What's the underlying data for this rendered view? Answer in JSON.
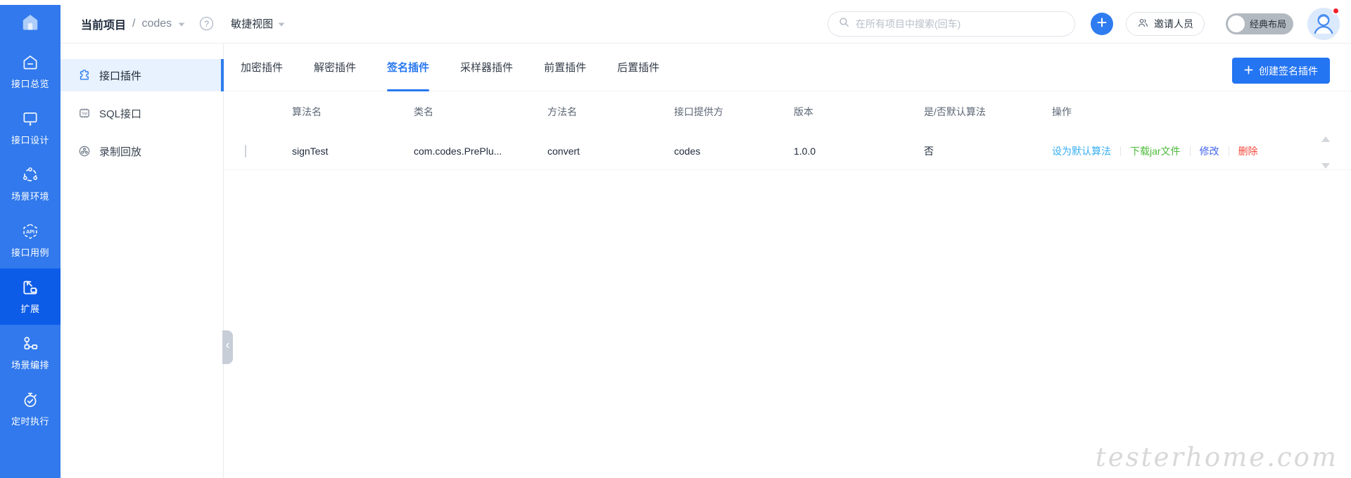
{
  "header": {
    "breadcrumb": {
      "label": "当前项目",
      "separator": "/",
      "project": "codes"
    },
    "view_switcher": "敏捷视图",
    "help": "?",
    "search": {
      "placeholder": "在所有项目中搜索(回车)"
    },
    "invite_button": "邀请人员",
    "layout_toggle": "经典布局"
  },
  "sidebar": {
    "items": [
      {
        "label": "接口总览",
        "icon": "api-overview-icon",
        "active": false
      },
      {
        "label": "接口设计",
        "icon": "api-design-icon",
        "active": false
      },
      {
        "label": "场景环境",
        "icon": "scene-env-icon",
        "active": false
      },
      {
        "label": "接口用例",
        "icon": "api-case-icon",
        "active": false
      },
      {
        "label": "扩展",
        "icon": "expand-icon",
        "active": true
      },
      {
        "label": "场景编排",
        "icon": "scene-orchestration-icon",
        "active": false
      },
      {
        "label": "定时执行",
        "icon": "timer-icon",
        "active": false
      }
    ]
  },
  "subsidebar": {
    "items": [
      {
        "label": "接口插件",
        "icon": "plugin-puzzle-icon",
        "active": true
      },
      {
        "label": "SQL接口",
        "icon": "sql-chip-icon",
        "active": false
      },
      {
        "label": "录制回放",
        "icon": "record-playback-icon",
        "active": false
      }
    ]
  },
  "plugins": {
    "tabs": [
      {
        "label": "加密插件",
        "active": false
      },
      {
        "label": "解密插件",
        "active": false
      },
      {
        "label": "签名插件",
        "active": true
      },
      {
        "label": "采样器插件",
        "active": false
      },
      {
        "label": "前置插件",
        "active": false
      },
      {
        "label": "后置插件",
        "active": false
      }
    ],
    "create_button": "创建签名插件"
  },
  "table": {
    "columns": [
      "算法名",
      "类名",
      "方法名",
      "接口提供方",
      "版本",
      "是/否默认算法",
      "操作"
    ],
    "rows": [
      {
        "algorithm": "signTest",
        "class_name": "com.codes.PrePlu...",
        "method": "convert",
        "provider": "codes",
        "version": "1.0.0",
        "is_default": "否",
        "actions": [
          {
            "label": "设为默认算法",
            "color": "#36aef2"
          },
          {
            "label": "下载jar文件",
            "color": "#4dbb3a"
          },
          {
            "label": "修改",
            "color": "#4263eb"
          },
          {
            "label": "删除",
            "color": "#f5483b"
          }
        ]
      }
    ]
  },
  "watermark": "testerhome.com",
  "colors": {
    "sidebar": "#3179ec",
    "sidebar_active": "#0d5ce8",
    "accent": "#2e7cf0",
    "active_tab": "#2878f0",
    "subsidebar_active_bg": "#e8f1fe",
    "avatar_dot": "#f5222d"
  }
}
